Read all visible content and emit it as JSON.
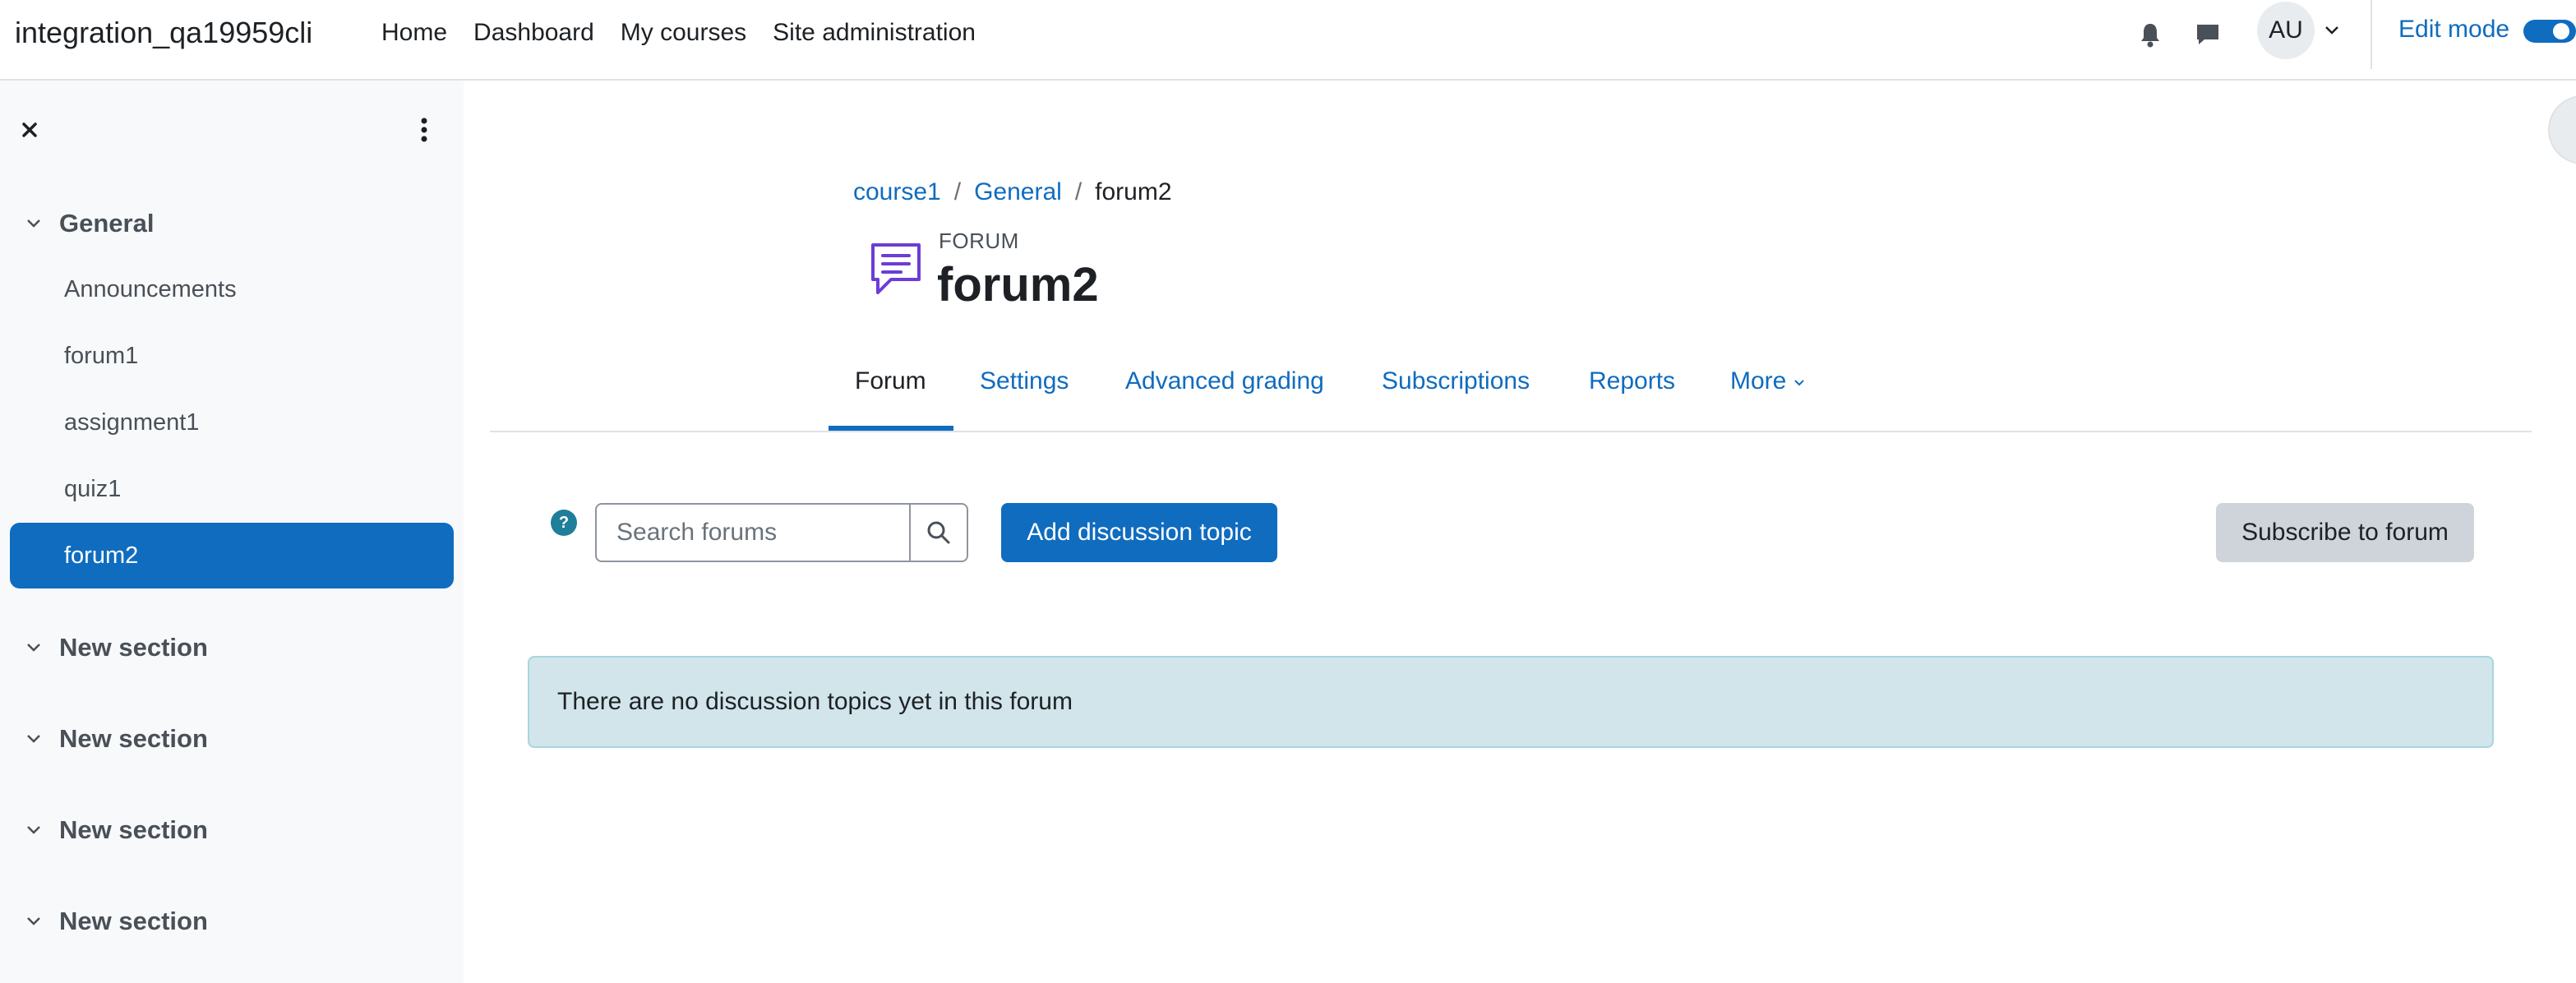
{
  "navbar": {
    "site_name": "integration_qa19959cli",
    "links": [
      "Home",
      "Dashboard",
      "My courses",
      "Site administration"
    ],
    "icons": {
      "notifications": "bell-icon",
      "messages": "chat-bubble-icon"
    },
    "user_initials": "AU",
    "edit_mode_label": "Edit mode",
    "edit_mode_on": true
  },
  "drawer": {
    "sections": [
      {
        "title": "General",
        "expanded": true,
        "activities": [
          "Announcements",
          "forum1",
          "assignment1",
          "quiz1",
          "forum2"
        ]
      },
      {
        "title": "New section"
      },
      {
        "title": "New section"
      },
      {
        "title": "New section"
      },
      {
        "title": "New section"
      }
    ],
    "active_activity": "forum2"
  },
  "breadcrumb": {
    "items": [
      "course1",
      "General"
    ],
    "current": "forum2"
  },
  "header": {
    "module_type": "FORUM",
    "title": "forum2"
  },
  "tabs": [
    "Forum",
    "Settings",
    "Advanced grading",
    "Subscriptions",
    "Reports",
    "More"
  ],
  "active_tab": "Forum",
  "toolbar": {
    "search_placeholder": "Search forums",
    "add_topic_label": "Add discussion topic",
    "subscribe_label": "Subscribe to forum",
    "help_glyph": "?"
  },
  "notice": "There are no discussion topics yet in this forum",
  "colors": {
    "primary": "#0f6cbf",
    "drawer_bg": "#f8f9fa",
    "alert_bg": "#d1e5ea",
    "forum_icon": "#6c3dd5"
  }
}
